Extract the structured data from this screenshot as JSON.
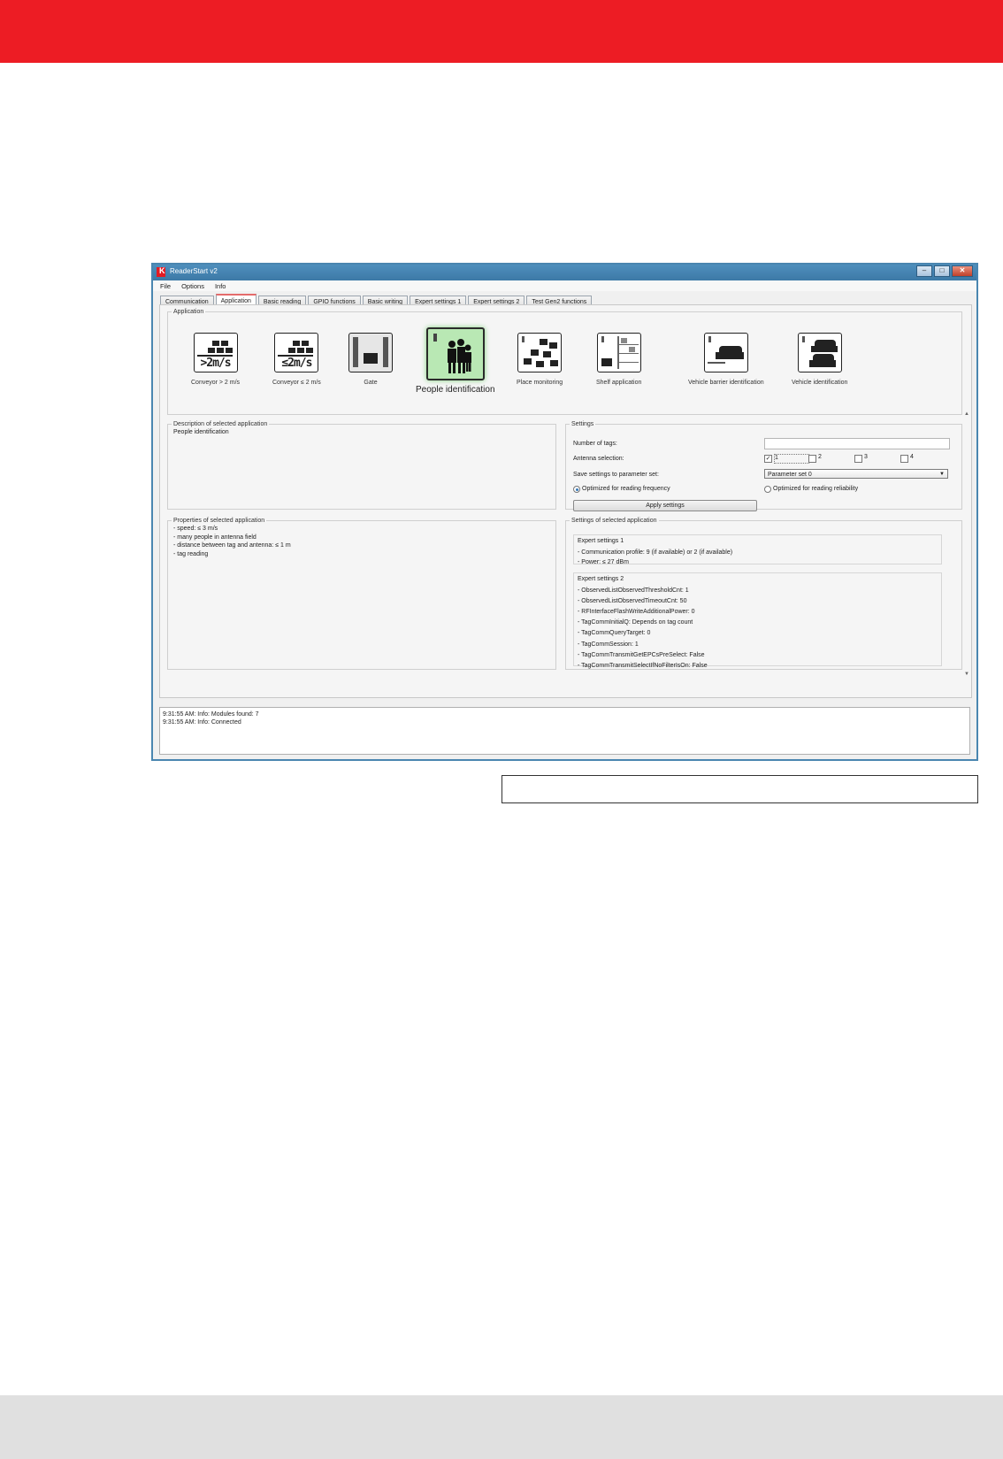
{
  "window": {
    "title": "ReaderStart v2",
    "logo_letter": "K",
    "controls": {
      "minimize": "–",
      "maximize": "□",
      "close": "✕"
    }
  },
  "menu": [
    "File",
    "Options",
    "Info"
  ],
  "tabs": [
    "Communication",
    "Application",
    "Basic reading",
    "GPIO functions",
    "Basic writing",
    "Expert settings 1",
    "Expert settings 2",
    "Test Gen2 functions"
  ],
  "active_tab": "Application",
  "application": {
    "legend": "Application",
    "items": [
      {
        "label": "Conveyor > 2 m/s",
        "badge": ">2m/s",
        "icon": "conveyor-fast-icon"
      },
      {
        "label": "Conveyor ≤ 2 m/s",
        "badge": "≤2m/s",
        "icon": "conveyor-slow-icon"
      },
      {
        "label": "Gate",
        "icon": "gate-icon"
      },
      {
        "label": "People identification",
        "icon": "people-icon",
        "selected": true
      },
      {
        "label": "Place monitoring",
        "icon": "place-monitoring-icon"
      },
      {
        "label": "Shelf application",
        "icon": "shelf-icon"
      },
      {
        "label": "Vehicle barrier identification",
        "icon": "vehicle-barrier-icon"
      },
      {
        "label": "Vehicle identification",
        "icon": "vehicle-icon"
      }
    ]
  },
  "description": {
    "legend": "Description of selected application",
    "text": "People identification"
  },
  "settings": {
    "legend": "Settings",
    "number_of_tags_label": "Number of tags:",
    "number_of_tags_value": "",
    "antenna_label": "Antenna selection:",
    "antennas": [
      {
        "label": "1",
        "checked": true
      },
      {
        "label": "2",
        "checked": false
      },
      {
        "label": "3",
        "checked": false
      },
      {
        "label": "4",
        "checked": false
      }
    ],
    "param_set_label": "Save settings to parameter set:",
    "param_set_value": "Parameter set 0",
    "radio_frequency": "Optimized for reading frequency",
    "radio_reliability": "Optimized for reading reliability",
    "radio_selected": "frequency",
    "apply_button": "Apply settings"
  },
  "properties": {
    "legend": "Properties of selected application",
    "lines": [
      "- speed: ≤ 3 m/s",
      "- many people in antenna field",
      "- distance between tag and antenna: ≤ 1 m",
      "- tag reading"
    ]
  },
  "selected_settings": {
    "legend": "Settings of selected application",
    "expert1_title": "Expert settings 1",
    "expert1_lines": [
      "- Communication profile: 9 (if available) or 2 (if available)",
      "- Power: ≤ 27 dBm"
    ],
    "expert2_title": "Expert settings 2",
    "expert2_lines": [
      "- ObservedListObservedThresholdCnt: 1",
      "- ObservedListObservedTimeoutCnt: 50",
      "- RFInterfaceFlashWriteAdditionalPower: 0",
      "- TagCommInitialQ: Depends on tag count",
      "- TagCommQueryTarget: 0",
      "- TagCommSession: 1",
      "- TagCommTransmitGetEPCsPreSelect: False",
      "- TagCommTransmitSelectIfNoFilterIsOn: False"
    ]
  },
  "log": [
    "9:31:55 AM: Info: Modules found: 7",
    "9:31:55 AM: Info: Connected"
  ],
  "colors": {
    "brand_red": "#ed1c24",
    "footer_gray": "#e0e0e0",
    "selected_green": "#b9e8b4"
  }
}
